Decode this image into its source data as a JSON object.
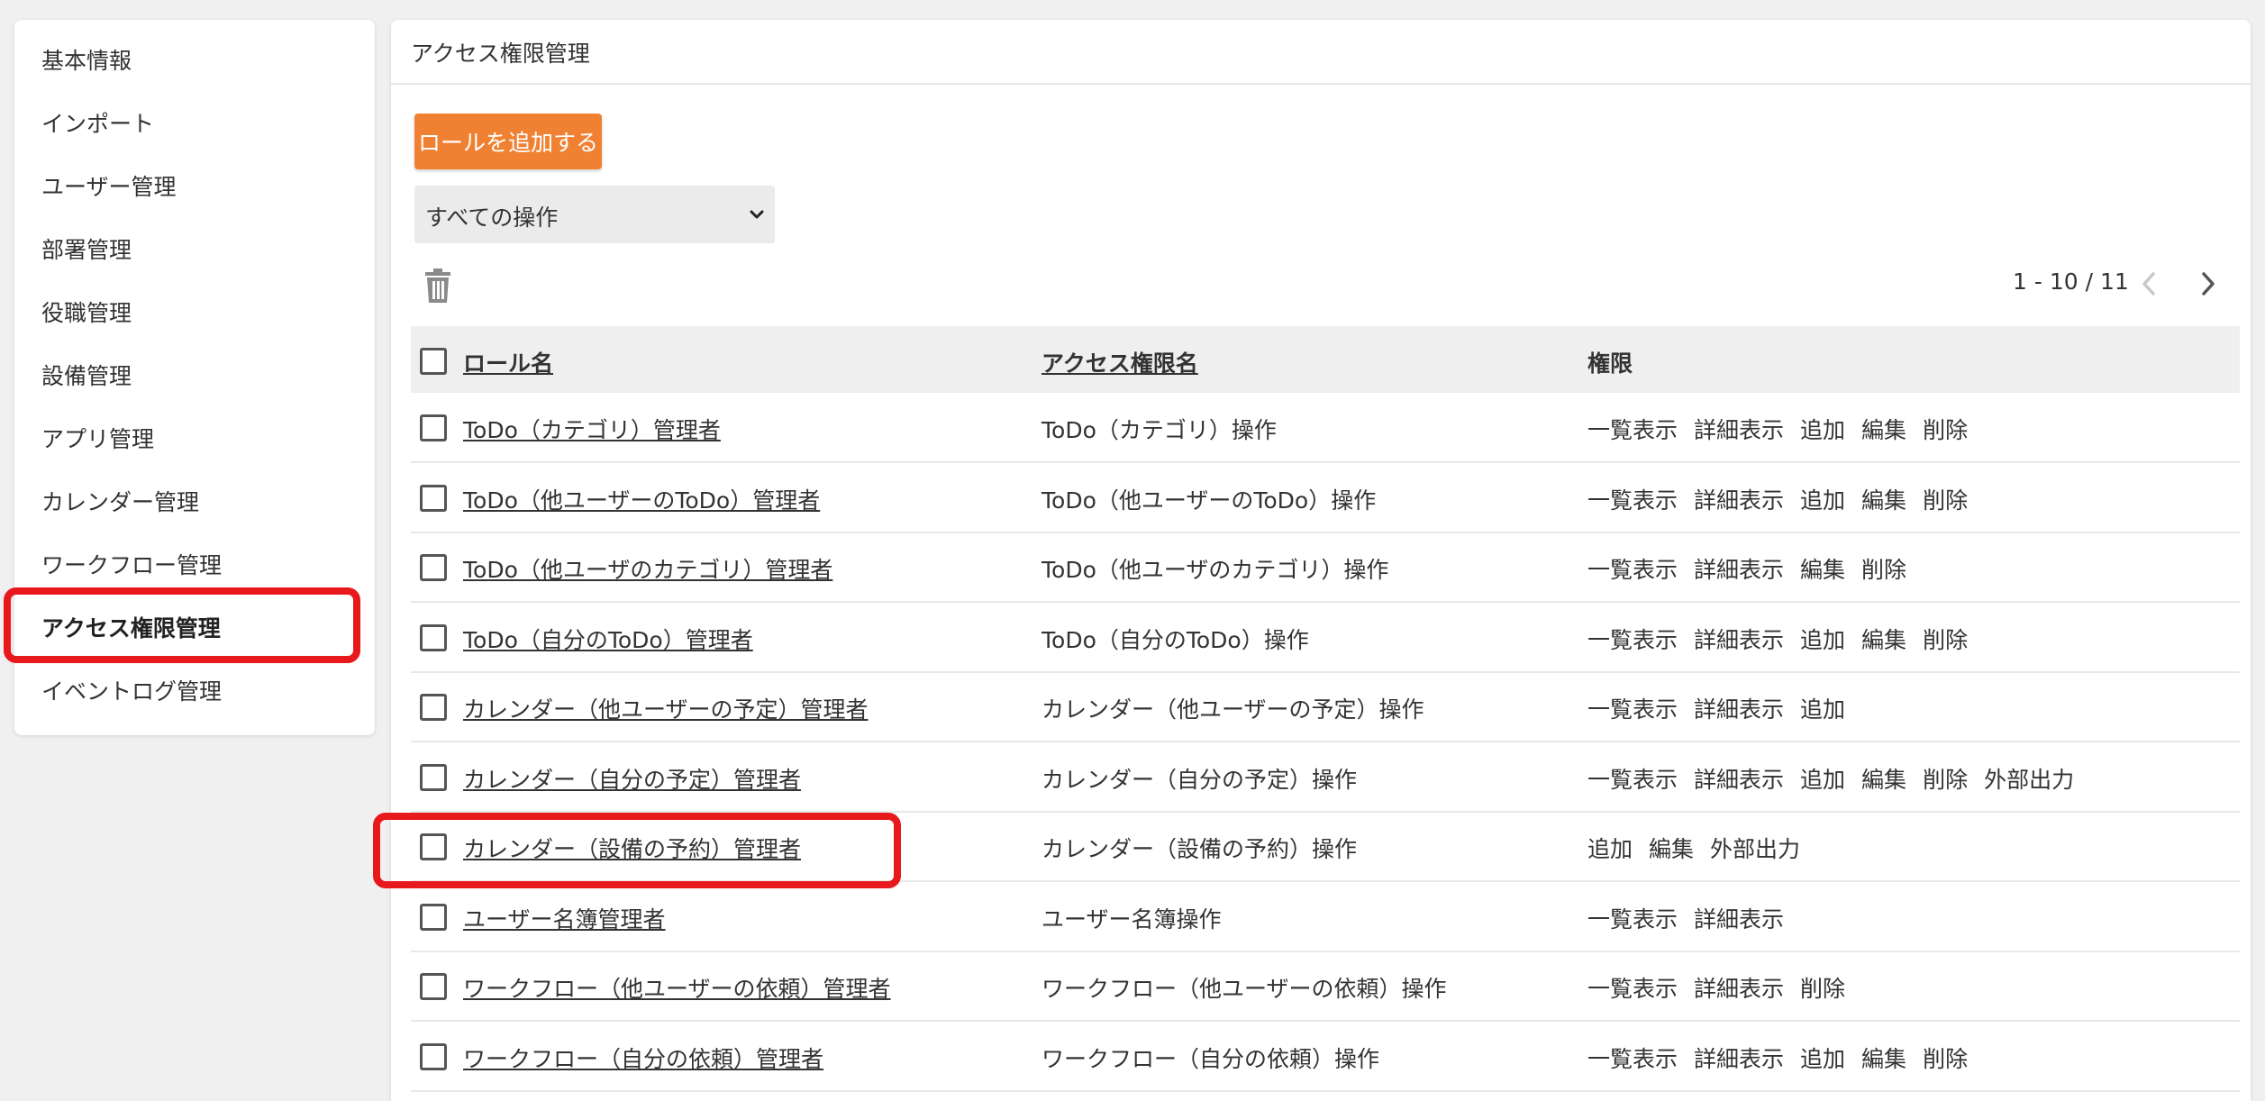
{
  "sidebar": {
    "items": [
      {
        "label": "基本情報",
        "active": false
      },
      {
        "label": "インポート",
        "active": false
      },
      {
        "label": "ユーザー管理",
        "active": false
      },
      {
        "label": "部署管理",
        "active": false
      },
      {
        "label": "役職管理",
        "active": false
      },
      {
        "label": "設備管理",
        "active": false
      },
      {
        "label": "アプリ管理",
        "active": false
      },
      {
        "label": "カレンダー管理",
        "active": false
      },
      {
        "label": "ワークフロー管理",
        "active": false
      },
      {
        "label": "アクセス権限管理",
        "active": true
      },
      {
        "label": "イベントログ管理",
        "active": false
      }
    ]
  },
  "main": {
    "title": "アクセス権限管理",
    "add_button": "ロールを追加する",
    "filter_select": "すべての操作",
    "pagination": "1 - 10 / 11"
  },
  "table": {
    "headers": {
      "role": "ロール名",
      "access": "アクセス権限名",
      "perm": "権限"
    },
    "rows": [
      {
        "role": "ToDo（カテゴリ）管理者",
        "access": "ToDo（カテゴリ）操作",
        "perms": [
          "一覧表示",
          "詳細表示",
          "追加",
          "編集",
          "削除"
        ]
      },
      {
        "role": "ToDo（他ユーザーのToDo）管理者",
        "access": "ToDo（他ユーザーのToDo）操作",
        "perms": [
          "一覧表示",
          "詳細表示",
          "追加",
          "編集",
          "削除"
        ]
      },
      {
        "role": "ToDo（他ユーザのカテゴリ）管理者",
        "access": "ToDo（他ユーザのカテゴリ）操作",
        "perms": [
          "一覧表示",
          "詳細表示",
          "編集",
          "削除"
        ]
      },
      {
        "role": "ToDo（自分のToDo）管理者",
        "access": "ToDo（自分のToDo）操作",
        "perms": [
          "一覧表示",
          "詳細表示",
          "追加",
          "編集",
          "削除"
        ]
      },
      {
        "role": "カレンダー（他ユーザーの予定）管理者",
        "access": "カレンダー（他ユーザーの予定）操作",
        "perms": [
          "一覧表示",
          "詳細表示",
          "追加"
        ]
      },
      {
        "role": "カレンダー（自分の予定）管理者",
        "access": "カレンダー（自分の予定）操作",
        "perms": [
          "一覧表示",
          "詳細表示",
          "追加",
          "編集",
          "削除",
          "外部出力"
        ]
      },
      {
        "role": "カレンダー（設備の予約）管理者",
        "access": "カレンダー（設備の予約）操作",
        "perms": [
          "追加",
          "編集",
          "外部出力"
        ]
      },
      {
        "role": "ユーザー名簿管理者",
        "access": "ユーザー名簿操作",
        "perms": [
          "一覧表示",
          "詳細表示"
        ]
      },
      {
        "role": "ワークフロー（他ユーザーの依頼）管理者",
        "access": "ワークフロー（他ユーザーの依頼）操作",
        "perms": [
          "一覧表示",
          "詳細表示",
          "削除"
        ]
      },
      {
        "role": "ワークフロー（自分の依頼）管理者",
        "access": "ワークフロー（自分の依頼）操作",
        "perms": [
          "一覧表示",
          "詳細表示",
          "追加",
          "編集",
          "削除"
        ]
      }
    ]
  },
  "colors": {
    "accent": "#f08132",
    "highlight": "#e8191c"
  }
}
